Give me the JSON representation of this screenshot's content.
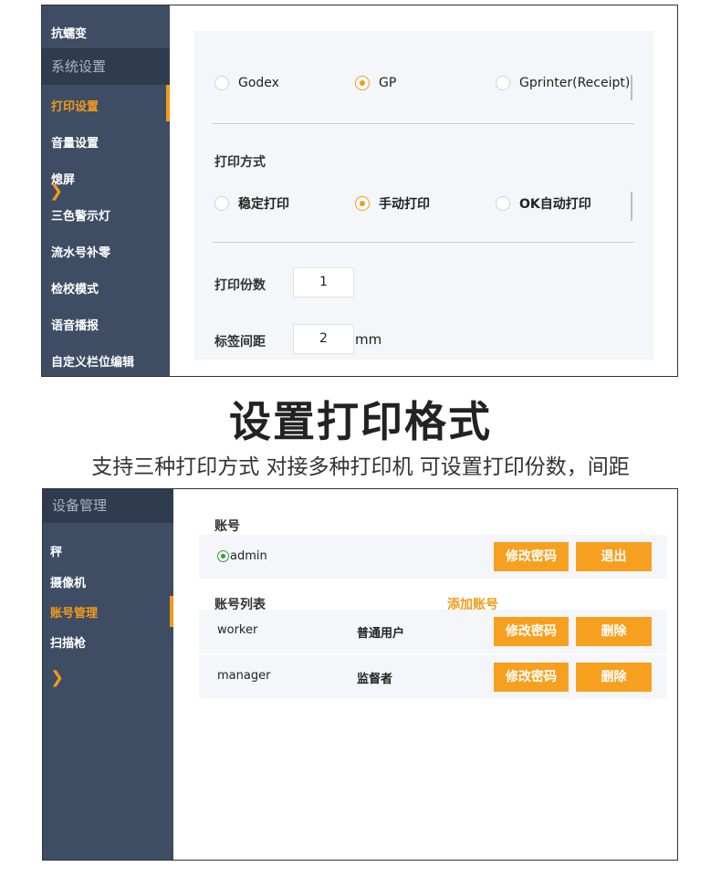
{
  "top_screenshot": {
    "sidebar": {
      "items_above": [
        "抗蠕变"
      ],
      "section_title": "系统设置",
      "items": [
        "打印设置",
        "音量设置",
        "熄屏",
        "三色警示灯",
        "流水号补零",
        "检校模式",
        "语音播报",
        "自定义栏位编辑"
      ],
      "active_item": "打印设置",
      "expand_icon": "chevron-right-icon"
    },
    "printer_options": [
      {
        "label": "Godex",
        "selected": false
      },
      {
        "label": "GP",
        "selected": true
      },
      {
        "label": "Gprinter(Receipt)",
        "selected": false
      }
    ],
    "print_mode": {
      "title": "打印方式",
      "options": [
        {
          "label": "稳定打印",
          "selected": false
        },
        {
          "label": "手动打印",
          "selected": true
        },
        {
          "label": "OK自动打印",
          "selected": false
        }
      ]
    },
    "copies": {
      "label": "打印份数",
      "value": "1"
    },
    "label_gap": {
      "label": "标签间距",
      "value": "2",
      "unit": "mm"
    }
  },
  "caption": {
    "title": "设置打印格式",
    "subtitle": "支持三种打印方式 对接多种打印机 可设置打印份数，间距"
  },
  "bottom_screenshot": {
    "sidebar": {
      "section_title": "设备管理",
      "items": [
        "秤",
        "摄像机",
        "账号管理",
        "扫描枪"
      ],
      "active_item": "账号管理",
      "expand_icon": "chevron-right-icon"
    },
    "account": {
      "title": "账号",
      "current_user": "admin",
      "change_password_label": "修改密码",
      "logout_label": "退出"
    },
    "account_list": {
      "title": "账号列表",
      "add_label": "添加账号",
      "rows": [
        {
          "name": "worker",
          "role": "普通用户",
          "change_password_label": "修改密码",
          "delete_label": "删除"
        },
        {
          "name": "manager",
          "role": "监督者",
          "change_password_label": "修改密码",
          "delete_label": "删除"
        }
      ]
    },
    "colors": {
      "accent": "#f29b1a",
      "sidebar": "#3e4d63",
      "online": "#2e9b3a"
    }
  }
}
